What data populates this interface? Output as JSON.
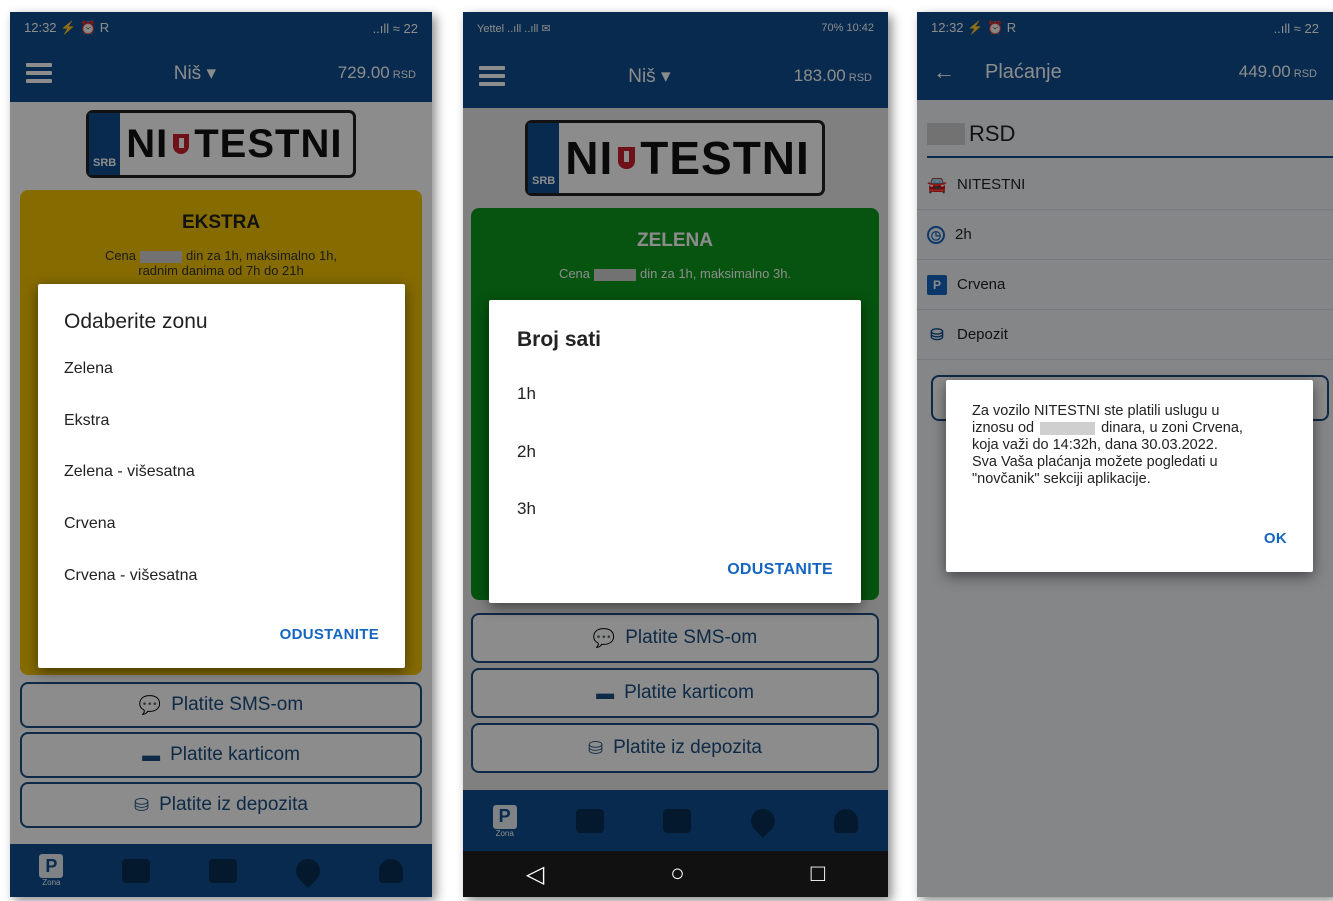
{
  "screens": [
    {
      "status": {
        "time": "12:32",
        "icons": "⚡ ⏰ R",
        "right": "..ıll ≈ 22"
      },
      "header": {
        "city": "Niš",
        "balance": "729.00",
        "currency": "RSD"
      },
      "plate": {
        "country": "SRB",
        "left": "NI",
        "right": "TESTNI"
      },
      "zone_card": {
        "title": "EKSTRA",
        "line1_pre": "Cena",
        "line1_post": "din za 1h, maksimalno 1h,",
        "line2": "radnim danima od 7h do 21h"
      },
      "dialog": {
        "title": "Odaberite zonu",
        "options": [
          "Zelena",
          "Ekstra",
          "Zelena - višesatna",
          "Crvena",
          "Crvena - višesatna"
        ],
        "cancel": "ODUSTANITE"
      },
      "pay_buttons": [
        "Platite SMS-om",
        "Platite karticom",
        "Platite iz depozita"
      ],
      "bottom_nav": [
        "Zona"
      ]
    },
    {
      "status": {
        "left": "Yettel ..ıll ..ıll ✉",
        "right": "70%  10:42"
      },
      "header": {
        "city": "Niš",
        "balance": "183.00",
        "currency": "RSD"
      },
      "plate": {
        "country": "SRB",
        "left": "NI",
        "right": "TESTNI"
      },
      "zone_card": {
        "title": "ZELENA",
        "line1_pre": "Cena",
        "line1_post": "din za 1h, maksimalno 3h."
      },
      "dialog": {
        "title": "Broj sati",
        "options": [
          "1h",
          "2h",
          "3h"
        ],
        "cancel": "ODUSTANITE"
      },
      "pay_buttons": [
        "Platite SMS-om",
        "Platite karticom",
        "Platite iz depozita"
      ],
      "bottom_nav": [
        "Zona"
      ],
      "sys_nav": [
        "◁",
        "○",
        "□"
      ]
    },
    {
      "status": {
        "time": "12:32",
        "icons": "⚡ ⏰ R",
        "right": "..ıll ≈ 22"
      },
      "header": {
        "back": "←",
        "title": "Plaćanje",
        "balance": "449.00",
        "currency": "RSD"
      },
      "amount_currency": "RSD",
      "rows": [
        {
          "icon": "car-icon",
          "label": "NITESTNI"
        },
        {
          "icon": "clock-icon",
          "label": "2h"
        },
        {
          "icon": "parking-icon",
          "label": "Crvena"
        },
        {
          "icon": "coins-icon",
          "label": "Depozit"
        }
      ],
      "dialog": {
        "line1": "Za vozilo NITESTNI ste platili uslugu u",
        "line2_pre": "iznosu od",
        "line2_post": "dinara, u zoni Crvena,",
        "line3": "koja važi do 14:32h, dana 30.03.2022.",
        "line4": "Sva Vaša plaćanja možete pogledati u",
        "line5": "\"novčanik\" sekciji aplikacije.",
        "ok": "OK"
      }
    }
  ],
  "colors": {
    "primary": "#0e4e8e",
    "ekstra": "#f5c400",
    "zelena": "#0c9a1c",
    "accent": "#1565c0"
  }
}
